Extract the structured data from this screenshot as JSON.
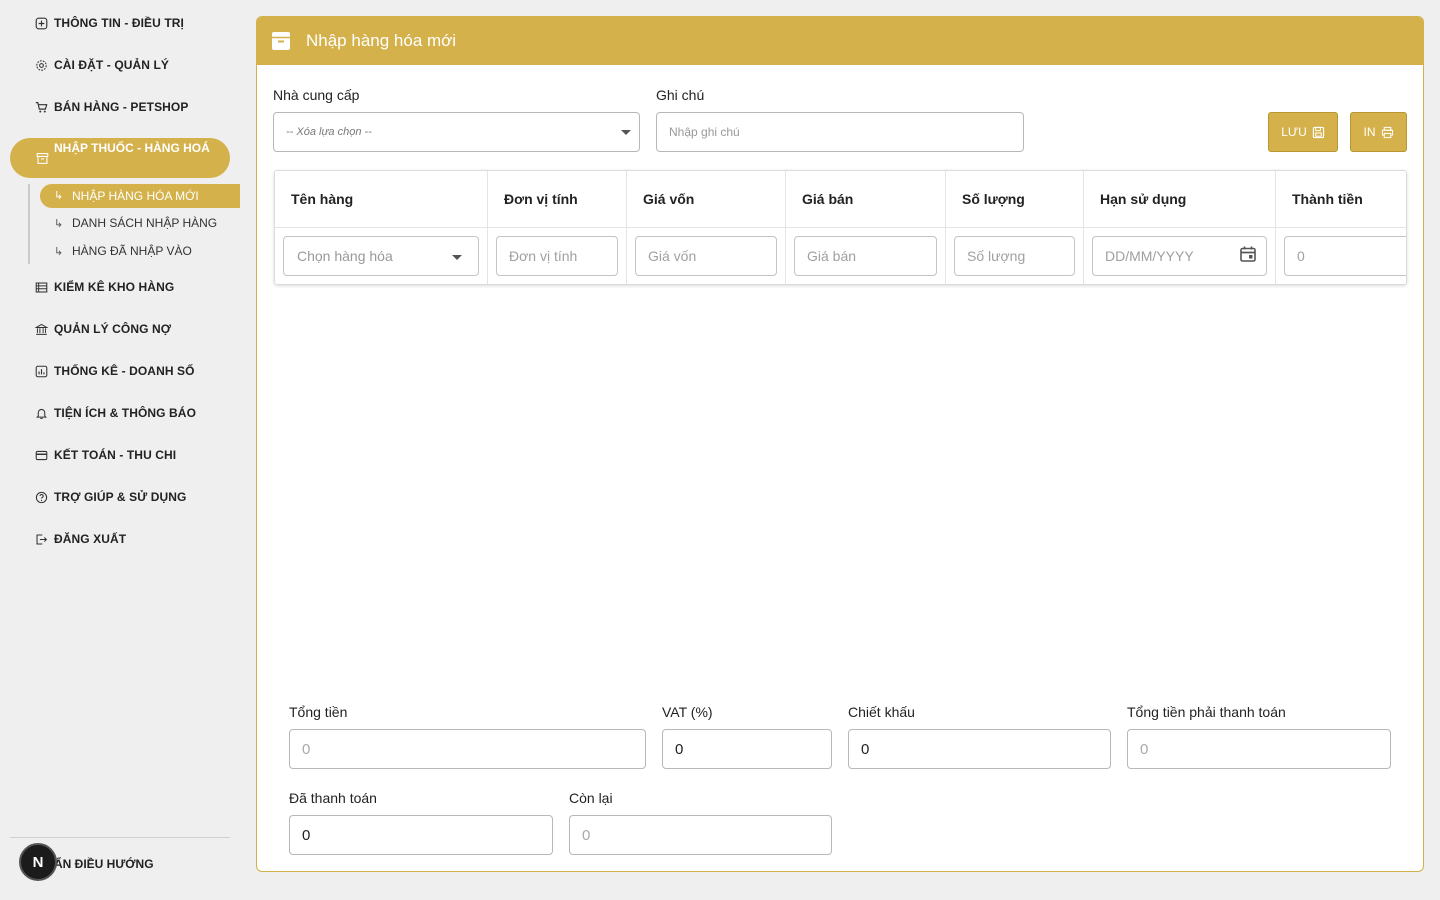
{
  "sidebar": {
    "items": [
      {
        "label": "THÔNG TIN - ĐIỀU TRỊ",
        "icon": "medical-icon"
      },
      {
        "label": "CÀI ĐẶT - QUẢN LÝ",
        "icon": "gear-icon"
      },
      {
        "label": "BÁN HÀNG - PETSHOP",
        "icon": "cart-icon"
      },
      {
        "label": "NHẬP THUỐC - HÀNG HOÁ",
        "icon": "archive-icon"
      },
      {
        "label": "KIỂM KÊ KHO HÀNG",
        "icon": "list-icon"
      },
      {
        "label": "QUẢN LÝ CÔNG NỢ",
        "icon": "bank-icon"
      },
      {
        "label": "THỐNG KÊ - DOANH SỐ",
        "icon": "chart-icon"
      },
      {
        "label": "TIỆN ÍCH & THÔNG BÁO",
        "icon": "bell-icon"
      },
      {
        "label": "KẾT TOÁN - THU CHI",
        "icon": "card-icon"
      },
      {
        "label": "TRỢ GIÚP & SỬ DỤNG",
        "icon": "help-icon"
      },
      {
        "label": "ĐĂNG XUẤT",
        "icon": "logout-icon"
      }
    ],
    "sub_items": [
      {
        "label": "NHẬP HÀNG HÓA MỚI"
      },
      {
        "label": "DANH SÁCH NHẬP HÀNG"
      },
      {
        "label": "HÀNG ĐÃ NHẬP VÀO"
      }
    ],
    "collapse_label": "ẨN ĐIỀU HƯỚNG",
    "badge_letter": "N"
  },
  "panel": {
    "title": "Nhập hàng hóa mới",
    "supplier_label": "Nhà cung cấp",
    "supplier_value": "-- Xóa lựa chọn --",
    "note_label": "Ghi chú",
    "note_placeholder": "Nhập ghi chú",
    "save_label": "LƯU",
    "print_label": "IN"
  },
  "table": {
    "headers": [
      "Tên hàng",
      "Đơn vị tính",
      "Giá vốn",
      "Giá bán",
      "Số lượng",
      "Hạn sử dụng",
      "Thành tiền"
    ],
    "row": {
      "product_placeholder": "Chọn hàng hóa",
      "unit_placeholder": "Đơn vị tính",
      "cost_placeholder": "Giá vốn",
      "price_placeholder": "Giá bán",
      "qty_placeholder": "Số lượng",
      "expiry_placeholder": "DD/MM/YYYY",
      "total_placeholder": "0"
    }
  },
  "totals": {
    "total_label": "Tổng tiền",
    "total_placeholder": "0",
    "vat_label": "VAT (%)",
    "vat_value": "0",
    "discount_label": "Chiết khấu",
    "discount_value": "0",
    "payable_label": "Tổng tiền phải thanh toán",
    "payable_placeholder": "0",
    "paid_label": "Đã thanh toán",
    "paid_value": "0",
    "remaining_label": "Còn lại",
    "remaining_placeholder": "0"
  },
  "colors": {
    "accent": "#d4b14a",
    "background": "#efefef"
  }
}
